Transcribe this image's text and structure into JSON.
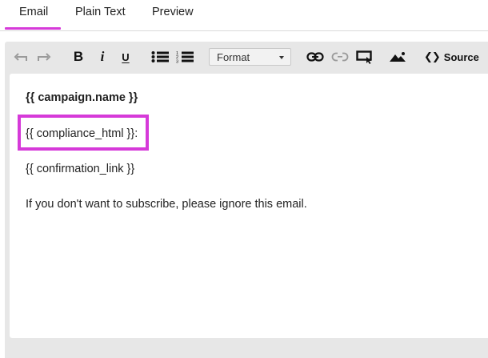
{
  "tabs": [
    {
      "label": "Email",
      "active": true
    },
    {
      "label": "Plain Text",
      "active": false
    },
    {
      "label": "Preview",
      "active": false
    }
  ],
  "colors": {
    "accent": "#d63ad9",
    "toolbar_bg": "#e7e7e7",
    "content_bg": "#ffffff"
  },
  "toolbar": {
    "icons": [
      "undo-icon",
      "redo-icon",
      "bold-icon",
      "italic-icon",
      "underline-icon",
      "bullet-list-icon",
      "numbered-list-icon",
      "link-icon",
      "unlink-icon",
      "insert-button-icon",
      "image-icon",
      "source-code-icon"
    ],
    "bold_label": "B",
    "italic_label": "i",
    "underline_label": "U",
    "format": {
      "label": "Format"
    },
    "source_label": "Source"
  },
  "content": {
    "lines": [
      "{{ campaign.name }}",
      "{{ compliance_html }}:",
      "{{ confirmation_link }}",
      "If you don't want to subscribe, please ignore this email."
    ]
  }
}
